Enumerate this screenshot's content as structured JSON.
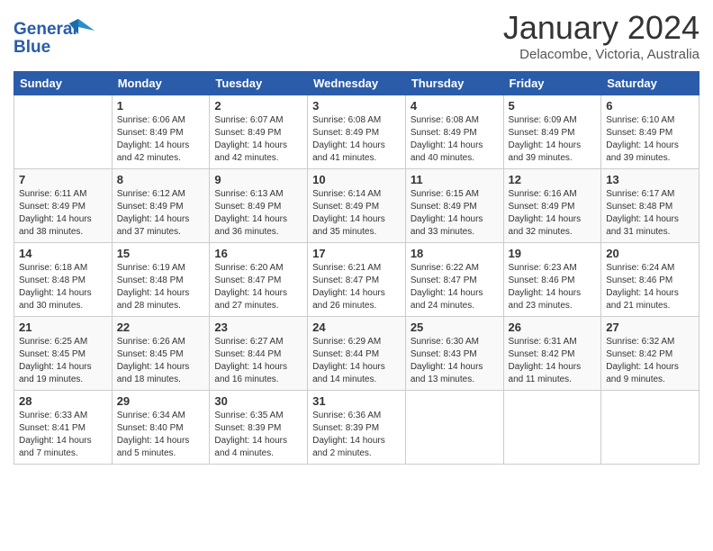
{
  "header": {
    "logo_line1": "General",
    "logo_line2": "Blue",
    "month_title": "January 2024",
    "location": "Delacombe, Victoria, Australia"
  },
  "weekdays": [
    "Sunday",
    "Monday",
    "Tuesday",
    "Wednesday",
    "Thursday",
    "Friday",
    "Saturday"
  ],
  "weeks": [
    [
      {
        "day": null,
        "info": null
      },
      {
        "day": "1",
        "info": "Sunrise: 6:06 AM\nSunset: 8:49 PM\nDaylight: 14 hours\nand 42 minutes."
      },
      {
        "day": "2",
        "info": "Sunrise: 6:07 AM\nSunset: 8:49 PM\nDaylight: 14 hours\nand 42 minutes."
      },
      {
        "day": "3",
        "info": "Sunrise: 6:08 AM\nSunset: 8:49 PM\nDaylight: 14 hours\nand 41 minutes."
      },
      {
        "day": "4",
        "info": "Sunrise: 6:08 AM\nSunset: 8:49 PM\nDaylight: 14 hours\nand 40 minutes."
      },
      {
        "day": "5",
        "info": "Sunrise: 6:09 AM\nSunset: 8:49 PM\nDaylight: 14 hours\nand 39 minutes."
      },
      {
        "day": "6",
        "info": "Sunrise: 6:10 AM\nSunset: 8:49 PM\nDaylight: 14 hours\nand 39 minutes."
      }
    ],
    [
      {
        "day": "7",
        "info": "Sunrise: 6:11 AM\nSunset: 8:49 PM\nDaylight: 14 hours\nand 38 minutes."
      },
      {
        "day": "8",
        "info": "Sunrise: 6:12 AM\nSunset: 8:49 PM\nDaylight: 14 hours\nand 37 minutes."
      },
      {
        "day": "9",
        "info": "Sunrise: 6:13 AM\nSunset: 8:49 PM\nDaylight: 14 hours\nand 36 minutes."
      },
      {
        "day": "10",
        "info": "Sunrise: 6:14 AM\nSunset: 8:49 PM\nDaylight: 14 hours\nand 35 minutes."
      },
      {
        "day": "11",
        "info": "Sunrise: 6:15 AM\nSunset: 8:49 PM\nDaylight: 14 hours\nand 33 minutes."
      },
      {
        "day": "12",
        "info": "Sunrise: 6:16 AM\nSunset: 8:49 PM\nDaylight: 14 hours\nand 32 minutes."
      },
      {
        "day": "13",
        "info": "Sunrise: 6:17 AM\nSunset: 8:48 PM\nDaylight: 14 hours\nand 31 minutes."
      }
    ],
    [
      {
        "day": "14",
        "info": "Sunrise: 6:18 AM\nSunset: 8:48 PM\nDaylight: 14 hours\nand 30 minutes."
      },
      {
        "day": "15",
        "info": "Sunrise: 6:19 AM\nSunset: 8:48 PM\nDaylight: 14 hours\nand 28 minutes."
      },
      {
        "day": "16",
        "info": "Sunrise: 6:20 AM\nSunset: 8:47 PM\nDaylight: 14 hours\nand 27 minutes."
      },
      {
        "day": "17",
        "info": "Sunrise: 6:21 AM\nSunset: 8:47 PM\nDaylight: 14 hours\nand 26 minutes."
      },
      {
        "day": "18",
        "info": "Sunrise: 6:22 AM\nSunset: 8:47 PM\nDaylight: 14 hours\nand 24 minutes."
      },
      {
        "day": "19",
        "info": "Sunrise: 6:23 AM\nSunset: 8:46 PM\nDaylight: 14 hours\nand 23 minutes."
      },
      {
        "day": "20",
        "info": "Sunrise: 6:24 AM\nSunset: 8:46 PM\nDaylight: 14 hours\nand 21 minutes."
      }
    ],
    [
      {
        "day": "21",
        "info": "Sunrise: 6:25 AM\nSunset: 8:45 PM\nDaylight: 14 hours\nand 19 minutes."
      },
      {
        "day": "22",
        "info": "Sunrise: 6:26 AM\nSunset: 8:45 PM\nDaylight: 14 hours\nand 18 minutes."
      },
      {
        "day": "23",
        "info": "Sunrise: 6:27 AM\nSunset: 8:44 PM\nDaylight: 14 hours\nand 16 minutes."
      },
      {
        "day": "24",
        "info": "Sunrise: 6:29 AM\nSunset: 8:44 PM\nDaylight: 14 hours\nand 14 minutes."
      },
      {
        "day": "25",
        "info": "Sunrise: 6:30 AM\nSunset: 8:43 PM\nDaylight: 14 hours\nand 13 minutes."
      },
      {
        "day": "26",
        "info": "Sunrise: 6:31 AM\nSunset: 8:42 PM\nDaylight: 14 hours\nand 11 minutes."
      },
      {
        "day": "27",
        "info": "Sunrise: 6:32 AM\nSunset: 8:42 PM\nDaylight: 14 hours\nand 9 minutes."
      }
    ],
    [
      {
        "day": "28",
        "info": "Sunrise: 6:33 AM\nSunset: 8:41 PM\nDaylight: 14 hours\nand 7 minutes."
      },
      {
        "day": "29",
        "info": "Sunrise: 6:34 AM\nSunset: 8:40 PM\nDaylight: 14 hours\nand 5 minutes."
      },
      {
        "day": "30",
        "info": "Sunrise: 6:35 AM\nSunset: 8:39 PM\nDaylight: 14 hours\nand 4 minutes."
      },
      {
        "day": "31",
        "info": "Sunrise: 6:36 AM\nSunset: 8:39 PM\nDaylight: 14 hours\nand 2 minutes."
      },
      {
        "day": null,
        "info": null
      },
      {
        "day": null,
        "info": null
      },
      {
        "day": null,
        "info": null
      }
    ]
  ]
}
